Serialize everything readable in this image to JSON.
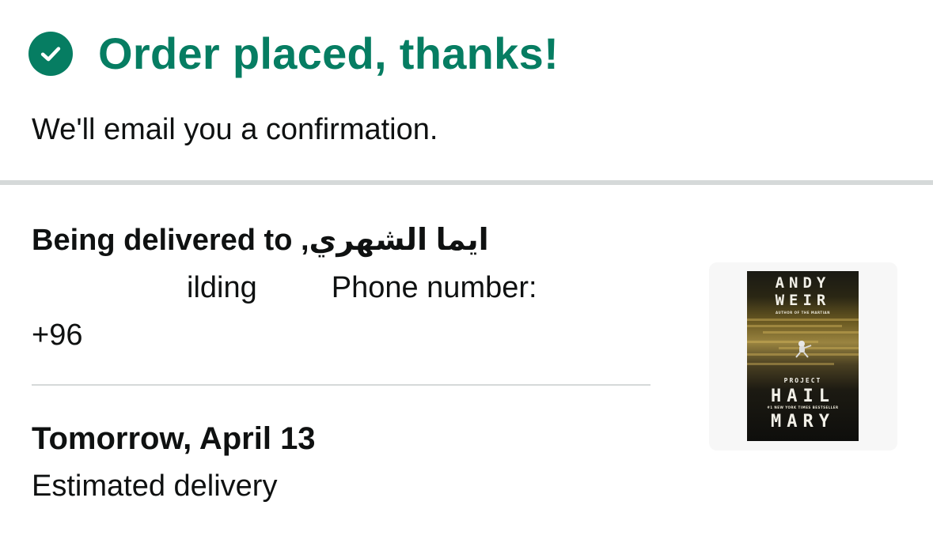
{
  "confirmation": {
    "icon": "check-circle-icon",
    "title": "Order placed, thanks!",
    "subtitle": "We'll email you a confirmation.",
    "accent_color": "#067d62"
  },
  "delivery": {
    "heading_prefix": "Being delivered to",
    "recipient_name": "ايما الشهري,",
    "address_line1_visible_a": "ilding",
    "address_line1_visible_b": "Phone number:",
    "address_line2_visible": "+96"
  },
  "eta": {
    "date": "Tomorrow, April 13",
    "label": "Estimated delivery"
  },
  "product": {
    "cover_author": [
      "ANDY",
      "WEIR"
    ],
    "cover_title": [
      "PROJECT",
      "HAIL",
      "MARY"
    ],
    "cover_tagline": "AUTHOR OF THE MARTIAN",
    "cover_bestseller": "#1 NEW YORK TIMES BESTSELLER"
  }
}
